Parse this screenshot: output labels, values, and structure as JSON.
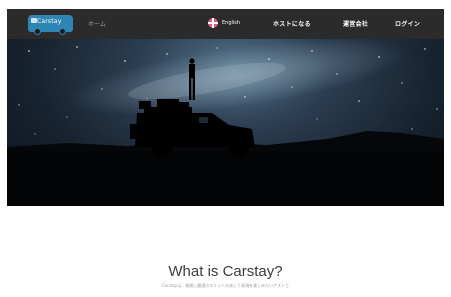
{
  "nav": {
    "logo_text": "Carstay",
    "home_label": "ホーム",
    "lang_label": "English",
    "host_label": "ホストになる",
    "company_label": "運営会社",
    "login_label": "ログイン"
  },
  "section": {
    "title": "What is Carstay?",
    "subtitle": "Carstayは、物理に最適のスミットのあして表現を楽しみたいゲストと"
  },
  "colors": {
    "nav_bg": "#2b2b2b",
    "logo_blue": "#2f86b5",
    "flag_pink": "#d85a8e",
    "title_text": "#3c3c3c"
  }
}
